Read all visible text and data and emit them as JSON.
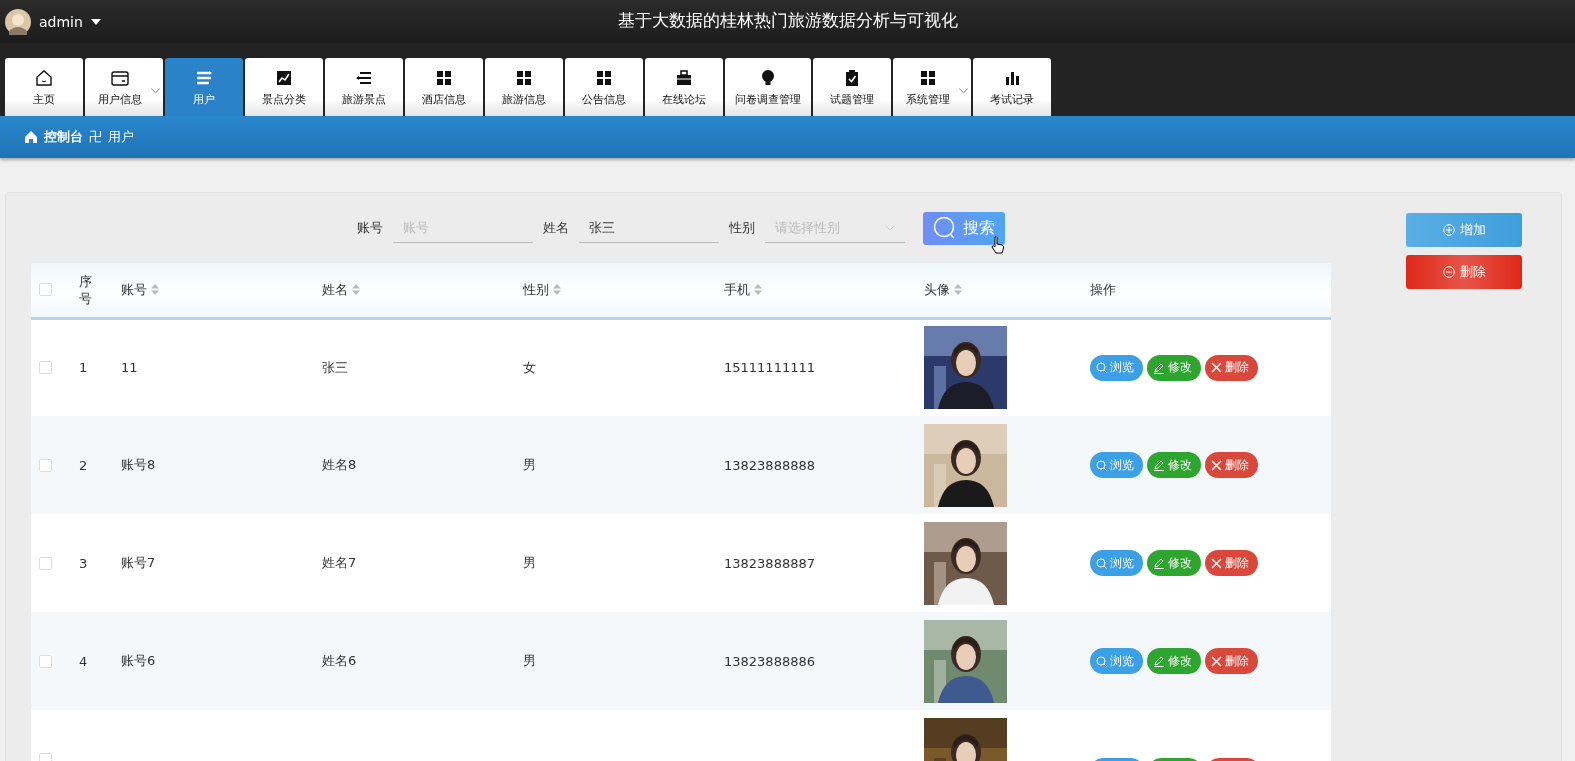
{
  "header": {
    "user": "admin",
    "title": "基于大数据的桂林热门旅游数据分析与可视化"
  },
  "nav": [
    {
      "label": "主页",
      "selected": false,
      "dropdown": false
    },
    {
      "label": "用户信息",
      "selected": false,
      "dropdown": true
    },
    {
      "label": "用户",
      "selected": true,
      "dropdown": false
    },
    {
      "label": "景点分类",
      "selected": false,
      "dropdown": false
    },
    {
      "label": "旅游景点",
      "selected": false,
      "dropdown": false
    },
    {
      "label": "酒店信息",
      "selected": false,
      "dropdown": false
    },
    {
      "label": "旅游信息",
      "selected": false,
      "dropdown": false
    },
    {
      "label": "公告信息",
      "selected": false,
      "dropdown": false
    },
    {
      "label": "在线论坛",
      "selected": false,
      "dropdown": false
    },
    {
      "label": "问卷调查管理",
      "selected": false,
      "dropdown": false
    },
    {
      "label": "试题管理",
      "selected": false,
      "dropdown": false
    },
    {
      "label": "系统管理",
      "selected": false,
      "dropdown": true
    },
    {
      "label": "考试记录",
      "selected": false,
      "dropdown": false
    }
  ],
  "breadcrumb": [
    "控制台",
    "卍",
    "用户"
  ],
  "search": {
    "fields": [
      {
        "kind": "input",
        "label": "账号",
        "placeholder": "账号"
      },
      {
        "kind": "input",
        "label": "姓名",
        "value": "张三"
      },
      {
        "kind": "select",
        "label": "性别",
        "placeholder": "请选择性别"
      }
    ],
    "button": "搜索"
  },
  "side_buttons": [
    {
      "kind": "add",
      "label": "增加"
    },
    {
      "kind": "delete",
      "label": "删除"
    }
  ],
  "table": {
    "all_checked": false,
    "columns": [
      {
        "label": "序号",
        "sortable": false
      },
      {
        "label": "账号",
        "sortable": true
      },
      {
        "label": "姓名",
        "sortable": true
      },
      {
        "label": "性别",
        "sortable": true
      },
      {
        "label": "手机",
        "sortable": true
      },
      {
        "label": "头像",
        "sortable": true
      },
      {
        "label": "操作",
        "sortable": false
      }
    ],
    "rows": [
      {
        "checked": false,
        "cells": [
          "1",
          "11",
          "张三",
          "女",
          "15111111111"
        ],
        "actions": [
          "浏览",
          "修改",
          "删除"
        ]
      },
      {
        "checked": false,
        "cells": [
          "2",
          "账号8",
          "姓名8",
          "男",
          "13823888888"
        ],
        "actions": [
          "浏览",
          "修改",
          "删除"
        ]
      },
      {
        "checked": false,
        "cells": [
          "3",
          "账号7",
          "姓名7",
          "男",
          "13823888887"
        ],
        "actions": [
          "浏览",
          "修改",
          "删除"
        ]
      },
      {
        "checked": false,
        "cells": [
          "4",
          "账号6",
          "姓名6",
          "男",
          "13823888886"
        ],
        "actions": [
          "浏览",
          "修改",
          "删除"
        ]
      },
      {
        "checked": false,
        "cells": [],
        "actions": []
      }
    ]
  }
}
